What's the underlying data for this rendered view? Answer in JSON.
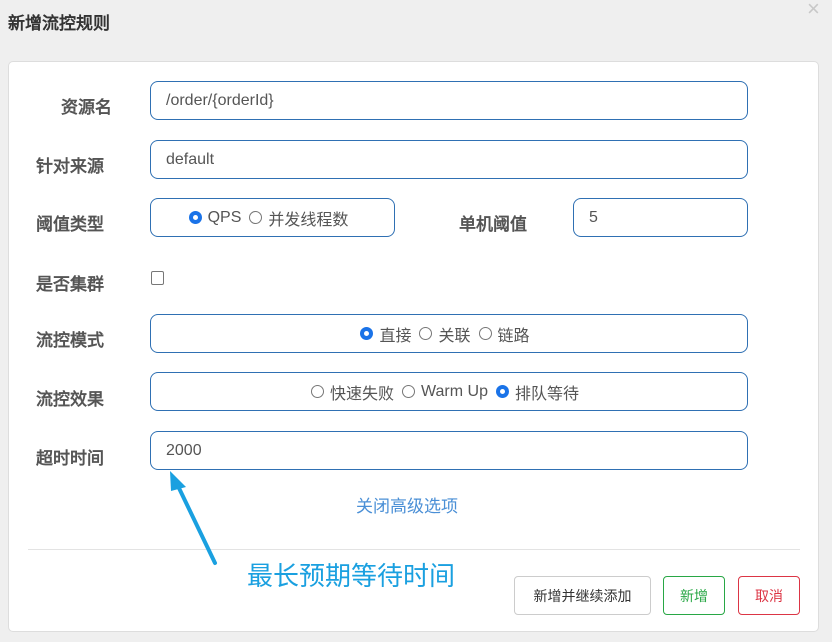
{
  "dialog": {
    "title": "新增流控规则",
    "close_icon": "close-icon"
  },
  "form": {
    "resource_label": "资源名",
    "resource_value": "/order/{orderId}",
    "source_label": "针对来源",
    "source_value": "default",
    "threshold_type_label": "阈值类型",
    "threshold_type_options": [
      "QPS",
      "并发线程数"
    ],
    "threshold_type_selected": "QPS",
    "single_threshold_label": "单机阈值",
    "single_threshold_value": "5",
    "cluster_label": "是否集群",
    "cluster_checked": false,
    "mode_label": "流控模式",
    "mode_options": [
      "直接",
      "关联",
      "链路"
    ],
    "mode_selected": "直接",
    "effect_label": "流控效果",
    "effect_options": [
      "快速失败",
      "Warm Up",
      "排队等待"
    ],
    "effect_selected": "排队等待",
    "timeout_label": "超时时间",
    "timeout_value": "2000",
    "advanced_link": "关闭高级选项"
  },
  "buttons": {
    "add_continue": "新增并继续添加",
    "add": "新增",
    "cancel": "取消"
  },
  "annotation": {
    "text": "最长预期等待时间",
    "color": "#1aa0e0"
  }
}
